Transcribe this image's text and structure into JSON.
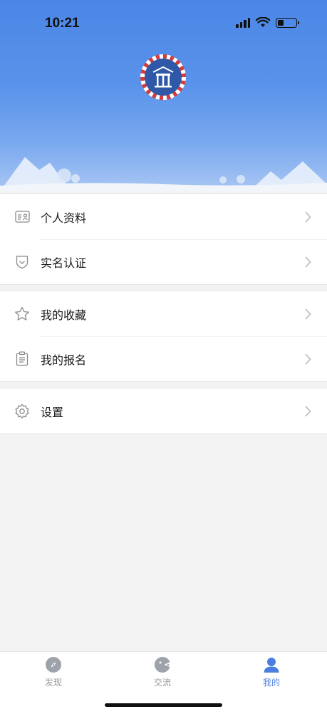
{
  "status_bar": {
    "time": "10:21",
    "battery_level": 0.35
  },
  "header": {
    "avatar_icon": "profile-avatar-badge"
  },
  "menu": {
    "group1": [
      {
        "label": "个人资料",
        "icon": "id-card-icon"
      },
      {
        "label": "实名认证",
        "icon": "shield-check-icon"
      }
    ],
    "group2": [
      {
        "label": "我的收藏",
        "icon": "star-icon"
      },
      {
        "label": "我的报名",
        "icon": "clipboard-icon"
      }
    ],
    "group3": [
      {
        "label": "设置",
        "icon": "gear-icon"
      }
    ]
  },
  "tabbar": {
    "tabs": [
      {
        "label": "发现",
        "icon": "compass-icon",
        "active": false
      },
      {
        "label": "交流",
        "icon": "chat-icon",
        "active": false
      },
      {
        "label": "我的",
        "icon": "user-icon",
        "active": true
      }
    ]
  },
  "colors": {
    "accent": "#4a7fe0",
    "header_top": "#4a86e6",
    "chevron": "#c2c2c2"
  }
}
